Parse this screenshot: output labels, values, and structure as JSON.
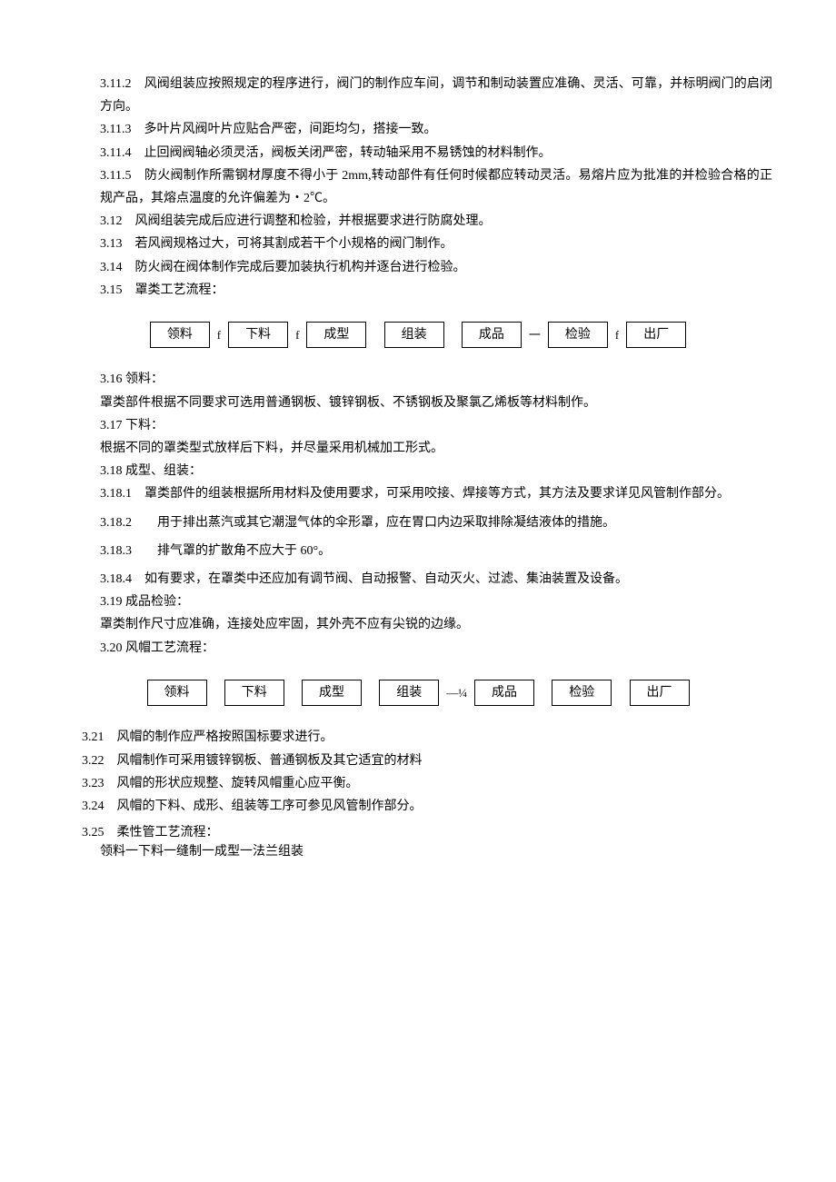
{
  "p": {
    "p1": "3.11.2　风阀组装应按照规定的程序进行，阀门的制作应车间，调节和制动装置应准确、灵活、可靠，并标明阀门的启闭方向。",
    "p2": "3.11.3　多叶片风阀叶片应贴合严密，间距均匀，搭接一致。",
    "p3": "3.11.4　止回阀阀轴必须灵活，阀板关闭严密，转动轴采用不易锈蚀的材料制作。",
    "p4": "3.11.5　防火阀制作所需钢材厚度不得小于 2mm,转动部件有任何时候都应转动灵活。易熔片应为批准的并检验合格的正规产品，其熔点温度的允许偏差为・2℃。",
    "p5": "3.12　风阀组装完成后应进行调整和检验，并根据要求进行防腐处理。",
    "p6": "3.13　若风阀规格过大，可将其割成若干个小规格的阀门制作。",
    "p7": "3.14　防火阀在阀体制作完成后要加装执行机构并逐台进行检验。",
    "p8": "3.15　罩类工艺流程：",
    "p9": "3.16 领料：",
    "p10": "罩类部件根据不同要求可选用普通钢板、镀锌钢板、不锈钢板及聚氯乙烯板等材料制作。",
    "p11": "3.17 下料：",
    "p12": "根据不同的罩类型式放样后下料，并尽量采用机械加工形式。",
    "p13": "3.18 成型、组装：",
    "p14": "3.18.1　罩类部件的组装根据所用材料及使用要求，可采用咬接、焊接等方式，其方法及要求详见风管制作部分。",
    "p15": "3.18.2　　用于排出蒸汽或其它潮湿气体的伞形罩，应在胃口内边采取排除凝结液体的措施。",
    "p16": "3.18.3　　排气罩的扩散角不应大于 60°。",
    "p17": "3.18.4　如有要求，在罩类中还应加有调节阀、自动报警、自动灭火、过滤、集油装置及设备。",
    "p18": "3.19 成品检验：",
    "p19": "罩类制作尺寸应准确，连接处应牢固，其外壳不应有尖锐的边缘。",
    "p20": "3.20 风帽工艺流程：",
    "p21": "3.21　风帽的制作应严格按照国标要求进行。",
    "p22": "3.22　风帽制作可采用镀锌钢板、普通钢板及其它适宜的材料",
    "p23": "3.23　风帽的形状应规整、旋转风帽重心应平衡。",
    "p24": "3.24　风帽的下料、成形、组装等工序可参见风管制作部分。",
    "p25a": "3.25　柔性管工艺流程：",
    "p25b": "领料一下料一缝制一成型一法兰组装"
  },
  "flow1": {
    "b1": "领料",
    "s1": "f",
    "b2": "下料",
    "s2": "f",
    "b3": "成型",
    "b4": "组装",
    "b5": "成品",
    "s5": "一",
    "b6": "检验",
    "s6": "f",
    "b7": "出厂"
  },
  "flow2": {
    "b1": "领料",
    "b2": "下料",
    "b3": "成型",
    "b4": "组装",
    "s4": "—¼",
    "b5": "成品",
    "b6": "检验",
    "b7": "出厂"
  }
}
